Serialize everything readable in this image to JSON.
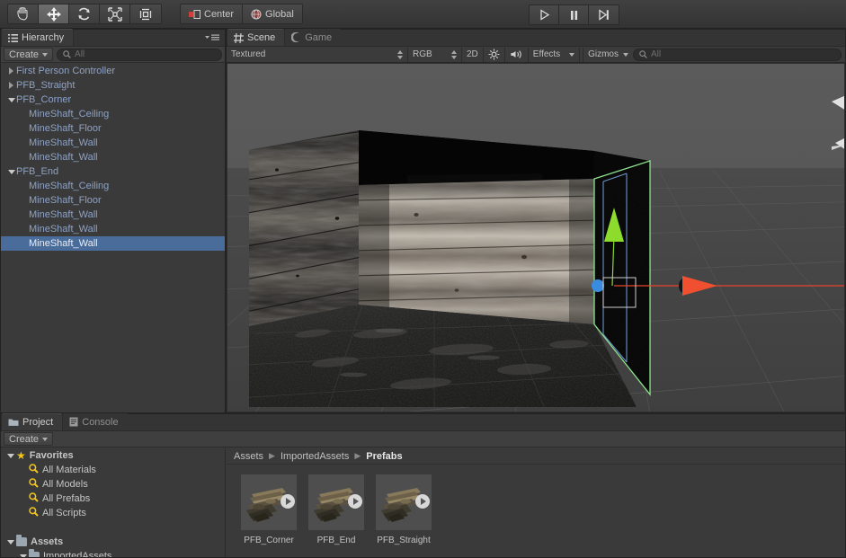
{
  "toolbar": {
    "tools": [
      {
        "name": "hand-tool",
        "icon": "hand",
        "active": false
      },
      {
        "name": "move-tool",
        "icon": "move",
        "active": true
      },
      {
        "name": "rotate-tool",
        "icon": "rotate",
        "active": false
      },
      {
        "name": "scale-tool",
        "icon": "scale",
        "active": false
      },
      {
        "name": "rect-tool",
        "icon": "rect",
        "active": false
      }
    ],
    "pivot_label": "Center",
    "space_label": "Global",
    "play_label": "play-icon",
    "pause_label": "pause-icon",
    "step_label": "step-icon"
  },
  "hierarchy": {
    "tab_label": "Hierarchy",
    "create_label": "Create",
    "search_value": "All",
    "items": [
      {
        "label": "First Person Controller",
        "depth": 0,
        "expander": "right",
        "selected": false
      },
      {
        "label": "PFB_Straight",
        "depth": 0,
        "expander": "right",
        "selected": false
      },
      {
        "label": "PFB_Corner",
        "depth": 0,
        "expander": "down",
        "selected": false
      },
      {
        "label": "MineShaft_Ceiling",
        "depth": 1,
        "expander": "none",
        "selected": false
      },
      {
        "label": "MineShaft_Floor",
        "depth": 1,
        "expander": "none",
        "selected": false
      },
      {
        "label": "MineShaft_Wall",
        "depth": 1,
        "expander": "none",
        "selected": false
      },
      {
        "label": "MineShaft_Wall",
        "depth": 1,
        "expander": "none",
        "selected": false
      },
      {
        "label": "PFB_End",
        "depth": 0,
        "expander": "down",
        "selected": false
      },
      {
        "label": "MineShaft_Ceiling",
        "depth": 1,
        "expander": "none",
        "selected": false
      },
      {
        "label": "MineShaft_Floor",
        "depth": 1,
        "expander": "none",
        "selected": false
      },
      {
        "label": "MineShaft_Wall",
        "depth": 1,
        "expander": "none",
        "selected": false
      },
      {
        "label": "MineShaft_Wall",
        "depth": 1,
        "expander": "none",
        "selected": false
      },
      {
        "label": "MineShaft_Wall",
        "depth": 1,
        "expander": "none",
        "selected": true
      }
    ]
  },
  "scene": {
    "tabs": [
      {
        "label": "Scene",
        "icon": "grid-icon",
        "active": true
      },
      {
        "label": "Game",
        "icon": "gamepad-icon",
        "active": false
      }
    ],
    "draw_mode": "Textured",
    "color_mode": "RGB",
    "mode_2d": "2D",
    "lighting_icon": "sun-icon",
    "audio_icon": "audio-icon",
    "effects_label": "Effects",
    "gizmos_label": "Gizmos",
    "gizmo_search_value": "All"
  },
  "project": {
    "tabs": [
      {
        "label": "Project",
        "icon": "folder-icon",
        "active": true
      },
      {
        "label": "Console",
        "icon": "console-icon",
        "active": false
      }
    ],
    "create_label": "Create",
    "search_placeholder": "",
    "tree": [
      {
        "label": "Favorites",
        "depth": 0,
        "expander": "down",
        "icon": "star-icon",
        "bold": true
      },
      {
        "label": "All Materials",
        "depth": 1,
        "expander": "none",
        "icon": "search-icon",
        "bold": false
      },
      {
        "label": "All Models",
        "depth": 1,
        "expander": "none",
        "icon": "search-icon",
        "bold": false
      },
      {
        "label": "All Prefabs",
        "depth": 1,
        "expander": "none",
        "icon": "search-icon",
        "bold": false
      },
      {
        "label": "All Scripts",
        "depth": 1,
        "expander": "none",
        "icon": "search-icon",
        "bold": false
      },
      {
        "label": "",
        "depth": 0,
        "expander": "none",
        "icon": "none",
        "bold": false
      },
      {
        "label": "Assets",
        "depth": 0,
        "expander": "down",
        "icon": "folder-icon",
        "bold": true
      },
      {
        "label": "ImportedAssets",
        "depth": 1,
        "expander": "down",
        "icon": "folder-icon",
        "bold": false
      }
    ],
    "breadcrumb": [
      "Assets",
      "ImportedAssets",
      "Prefabs"
    ],
    "assets": [
      {
        "name": "PFB_Corner"
      },
      {
        "name": "PFB_End"
      },
      {
        "name": "PFB_Straight"
      }
    ]
  },
  "colors": {
    "panel_bg": "#3a3a3a",
    "toolbar_bg": "#3f3f3f",
    "selection_blue": "#4a6c9b",
    "hierarchy_text": "#8ea2c6",
    "favorite_yellow": "#f3c51a",
    "gizmo_x": "#e8442a",
    "gizmo_y": "#8ddb2d",
    "gizmo_z": "#3a8ce0",
    "selection_outline": "#8fe38f"
  }
}
